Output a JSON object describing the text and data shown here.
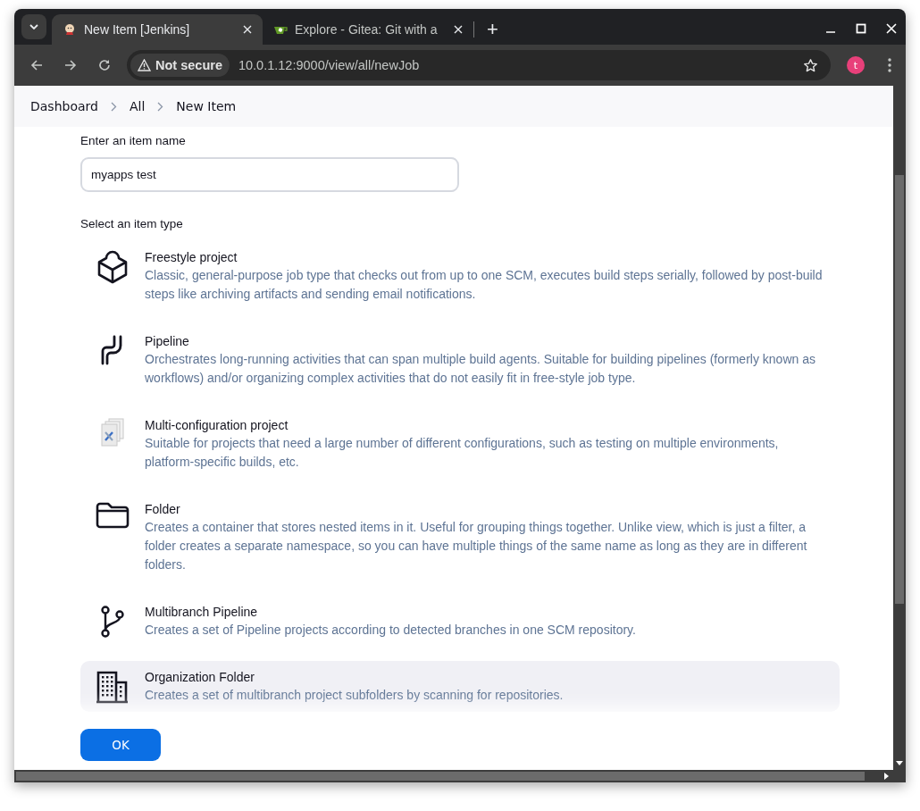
{
  "browser": {
    "tabs": [
      {
        "title": "New Item [Jenkins]",
        "kind": "jenkins",
        "selected": true
      },
      {
        "title": "Explore - Gitea: Git with a",
        "kind": "gitea",
        "selected": false
      }
    ],
    "new_tab": "+",
    "security": "Not secure",
    "url": "10.0.1.12:9000/view/all/newJob",
    "profile": "t"
  },
  "breadcrumbs": [
    "Dashboard",
    "All",
    "New Item"
  ],
  "name_field": {
    "label": "Enter an item name",
    "value": "myapps test"
  },
  "type_label": "Select an item type",
  "item_types": [
    {
      "kind": "cube",
      "title": "Freestyle project",
      "description": "Classic, general-purpose job type that checks out from up to one SCM, executes build steps serially, followed by post-build steps like archiving artifacts and sending email notifications.",
      "highlighted": false
    },
    {
      "kind": "pipeline",
      "title": "Pipeline",
      "description": "Orchestrates long-running activities that can span multiple build agents. Suitable for building pipelines (formerly known as workflows) and/or organizing complex activities that do not easily fit in free-style job type.",
      "highlighted": false
    },
    {
      "kind": "matrix",
      "title": "Multi-configuration project",
      "description": "Suitable for projects that need a large number of different configurations, such as testing on multiple environments, platform-specific builds, etc.",
      "highlighted": false
    },
    {
      "kind": "folder",
      "title": "Folder",
      "description": "Creates a container that stores nested items in it. Useful for grouping things together. Unlike view, which is just a filter, a folder creates a separate namespace, so you can have multiple things of the same name as long as they are in different folders.",
      "highlighted": false
    },
    {
      "kind": "branch",
      "title": "Multibranch Pipeline",
      "description": "Creates a set of Pipeline projects according to detected branches in one SCM repository.",
      "highlighted": false
    },
    {
      "kind": "building",
      "title": "Organization Folder",
      "description": "Creates a set of multibranch project subfolders by scanning for repositories.",
      "highlighted": true
    }
  ],
  "ok_button": "OK"
}
